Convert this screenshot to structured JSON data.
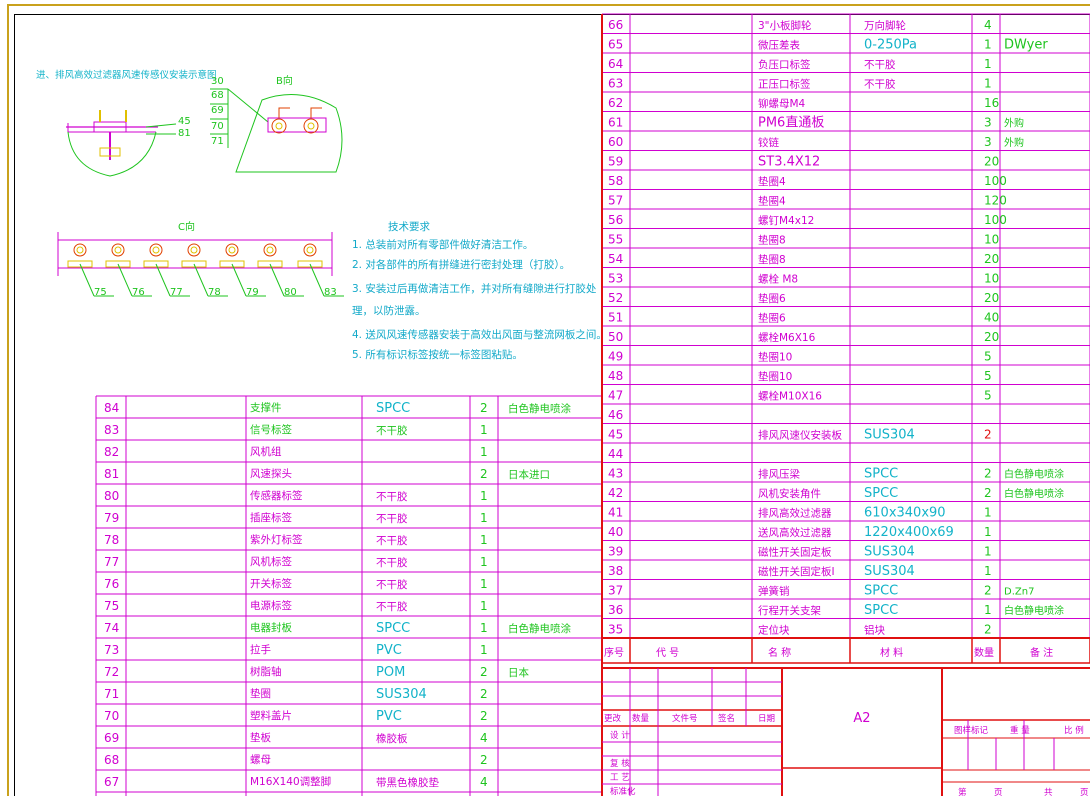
{
  "drawing_note": "进、排风高效过滤器风速传感仪安装示意图",
  "view_b_label": "B向",
  "view_c_label": "C向",
  "view_b_leaders": [
    "30",
    "68",
    "69",
    "70",
    "71"
  ],
  "view_a_leaders": [
    "45",
    "81"
  ],
  "view_c_leaders": [
    "75",
    "76",
    "77",
    "78",
    "79",
    "80",
    "83"
  ],
  "tech": {
    "title": "技术要求",
    "lines": [
      "1. 总装前对所有零部件做好清洁工作。",
      "2. 对各部件的所有拼缝进行密封处理（打胶）。",
      "3. 安装过后再做清洁工作，并对所有缝隙进行打胶处",
      "   理，以防泄露。",
      "4. 送风风速传感器安装于高效出风面与整流网板之间。",
      "5. 所有标识标签按统一标签图粘贴。"
    ]
  },
  "left_bom": [
    {
      "no": "84",
      "name": "支撑件",
      "mat": "SPCC",
      "qty": "2",
      "note": "白色静电喷涂"
    },
    {
      "no": "83",
      "name": "信号标签",
      "mat": "不干胶",
      "qty": "1",
      "note": ""
    },
    {
      "no": "82",
      "name": "风机组",
      "mat": "",
      "qty": "1",
      "note": ""
    },
    {
      "no": "81",
      "name": "风速探头",
      "mat": "",
      "qty": "2",
      "note": "日本进口"
    },
    {
      "no": "80",
      "name": "传感器标签",
      "mat": "不干胶",
      "qty": "1",
      "note": ""
    },
    {
      "no": "79",
      "name": "插座标签",
      "mat": "不干胶",
      "qty": "1",
      "note": ""
    },
    {
      "no": "78",
      "name": "紫外灯标签",
      "mat": "不干胶",
      "qty": "1",
      "note": ""
    },
    {
      "no": "77",
      "name": "风机标签",
      "mat": "不干胶",
      "qty": "1",
      "note": ""
    },
    {
      "no": "76",
      "name": "开关标签",
      "mat": "不干胶",
      "qty": "1",
      "note": ""
    },
    {
      "no": "75",
      "name": "电源标签",
      "mat": "不干胶",
      "qty": "1",
      "note": ""
    },
    {
      "no": "74",
      "name": "电器封板",
      "mat": "SPCC",
      "qty": "1",
      "note": "白色静电喷涂"
    },
    {
      "no": "73",
      "name": "拉手",
      "mat": "PVC",
      "qty": "1",
      "note": ""
    },
    {
      "no": "72",
      "name": "树脂轴",
      "mat": "POM",
      "qty": "2",
      "note": "日本"
    },
    {
      "no": "71",
      "name": "垫圈",
      "mat": "SUS304",
      "qty": "2",
      "note": ""
    },
    {
      "no": "70",
      "name": "塑料盖片",
      "mat": "PVC",
      "qty": "2",
      "note": ""
    },
    {
      "no": "69",
      "name": "垫板",
      "mat": "橡胶板",
      "qty": "4",
      "note": ""
    },
    {
      "no": "68",
      "name": "螺母",
      "mat": "",
      "qty": "2",
      "note": ""
    },
    {
      "no": "67",
      "name": "M16X140调整脚",
      "mat": "带黑色橡胶垫",
      "qty": "4",
      "note": ""
    }
  ],
  "left_header": {
    "no": "序号",
    "code": "代 号",
    "name": "名 称",
    "mat": "材 料",
    "qty": "数量",
    "note": "备 注"
  },
  "right_bom": [
    {
      "no": "66",
      "name": "3\"小板脚轮",
      "mat": "万向脚轮",
      "qty": "4",
      "note": ""
    },
    {
      "no": "65",
      "name": "微压差表",
      "mat": "0-250Pa",
      "qty": "1",
      "note": "DWyer"
    },
    {
      "no": "64",
      "name": "负压口标签",
      "mat": "不干胶",
      "qty": "1",
      "note": ""
    },
    {
      "no": "63",
      "name": "正压口标签",
      "mat": "不干胶",
      "qty": "1",
      "note": ""
    },
    {
      "no": "62",
      "name": "铆螺母M4",
      "mat": "",
      "qty": "16",
      "note": ""
    },
    {
      "no": "61",
      "name": "PM6直通板",
      "mat": "",
      "qty": "3",
      "note": "外购"
    },
    {
      "no": "60",
      "name": "铰链",
      "mat": "",
      "qty": "3",
      "note": "外购"
    },
    {
      "no": "59",
      "name": "ST3.4X12",
      "mat": "",
      "qty": "20",
      "note": ""
    },
    {
      "no": "58",
      "name": "垫圈4",
      "mat": "",
      "qty": "100",
      "note": ""
    },
    {
      "no": "57",
      "name": "垫圈4",
      "mat": "",
      "qty": "120",
      "note": ""
    },
    {
      "no": "56",
      "name": "螺钉M4x12",
      "mat": "",
      "qty": "100",
      "note": ""
    },
    {
      "no": "55",
      "name": "垫圈8",
      "mat": "",
      "qty": "10",
      "note": ""
    },
    {
      "no": "54",
      "name": "垫圈8",
      "mat": "",
      "qty": "20",
      "note": ""
    },
    {
      "no": "53",
      "name": "螺栓 M8",
      "mat": "",
      "qty": "10",
      "note": ""
    },
    {
      "no": "52",
      "name": "垫圈6",
      "mat": "",
      "qty": "20",
      "note": ""
    },
    {
      "no": "51",
      "name": "垫圈6",
      "mat": "",
      "qty": "40",
      "note": ""
    },
    {
      "no": "50",
      "name": "螺栓M6X16",
      "mat": "",
      "qty": "20",
      "note": ""
    },
    {
      "no": "49",
      "name": "垫圈10",
      "mat": "",
      "qty": "5",
      "note": ""
    },
    {
      "no": "48",
      "name": "垫圈10",
      "mat": "",
      "qty": "5",
      "note": ""
    },
    {
      "no": "47",
      "name": "螺栓M10X16",
      "mat": "",
      "qty": "5",
      "note": ""
    },
    {
      "no": "46",
      "name": "",
      "mat": "",
      "qty": "",
      "note": ""
    },
    {
      "no": "45",
      "name": "排风风速仪安装板",
      "mat": "SUS304",
      "qty": "2",
      "note": ""
    },
    {
      "no": "44",
      "name": "",
      "mat": "",
      "qty": "",
      "note": ""
    },
    {
      "no": "43",
      "name": "排风压梁",
      "mat": "SPCC",
      "qty": "2",
      "note": "白色静电喷涂"
    },
    {
      "no": "42",
      "name": "风机安装角件",
      "mat": "SPCC",
      "qty": "2",
      "note": "白色静电喷涂"
    },
    {
      "no": "41",
      "name": "排风高效过滤器",
      "mat": "610x340x90",
      "qty": "1",
      "note": ""
    },
    {
      "no": "40",
      "name": "送风高效过滤器",
      "mat": "1220x400x69",
      "qty": "1",
      "note": ""
    },
    {
      "no": "39",
      "name": "磁性开关固定板",
      "mat": "SUS304",
      "qty": "1",
      "note": ""
    },
    {
      "no": "38",
      "name": "磁性开关固定板I",
      "mat": "SUS304",
      "qty": "1",
      "note": ""
    },
    {
      "no": "37",
      "name": "弹簧销",
      "mat": "SPCC",
      "qty": "2",
      "note": "D.Zn7"
    },
    {
      "no": "36",
      "name": "行程开关支架",
      "mat": "SPCC",
      "qty": "1",
      "note": "白色静电喷涂"
    },
    {
      "no": "35",
      "name": "定位块",
      "mat": "铝块",
      "qty": "2",
      "note": ""
    }
  ],
  "right_header": {
    "no": "序号",
    "code": "代 号",
    "name": "名 称",
    "mat": "材 料",
    "qty": "数量",
    "note": "备 注"
  },
  "title_block": {
    "rev_headers": [
      "更改",
      "数量",
      "文件号",
      "签名",
      "日期"
    ],
    "roles": [
      "设 计",
      "复 核",
      "工 艺",
      "标准化"
    ],
    "sheet_size": "A2",
    "mark_labels": [
      "图样标记",
      "重 量",
      "比 例"
    ],
    "page_labels": [
      "第",
      "页",
      "共",
      "页"
    ]
  },
  "colors": {
    "magenta": "#d000d0",
    "green": "#1ec41e",
    "cyan": "#13b3c9",
    "red": "#e01010"
  }
}
